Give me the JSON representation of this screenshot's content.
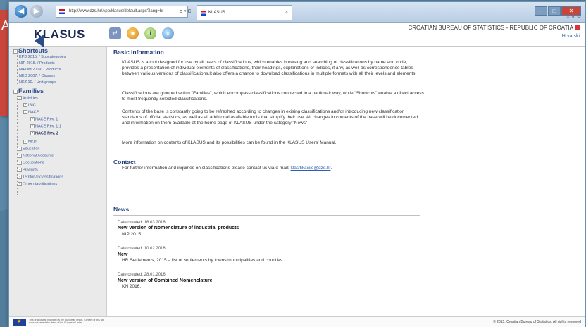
{
  "browser": {
    "address": "http://www.dzs.hr/App/klasus/default.aspx?lang=hr",
    "tab_title": "KLASUS",
    "back": "◀",
    "forward": "▶",
    "address_controls": "ρ ▾ C",
    "tab_close": "×",
    "win_min": "–",
    "win_max": "□",
    "win_close": "✕",
    "sys_icons": "⌂ ★ ⚙"
  },
  "header": {
    "logo": "KLASUS",
    "bureau": "CROATIAN BUREAU OF STATISTICS - REPUBLIC OF CROATIA",
    "language_link": "Hrvatski",
    "icon_home": "↵",
    "icon_globe": "●",
    "icon_info": "i",
    "icon_search": "⌕"
  },
  "sidebar": {
    "shortcuts_title": "Shortcuts",
    "shortcuts": [
      "KPD 2015. / Subcategories",
      "NIP 2015. / Products",
      "NIPUM 2009. / Products",
      "NKD 2007. / Classes",
      "NKZ 10. / Unit groups"
    ],
    "families_title": "Families",
    "activities": "Activities",
    "isic": "ISIC",
    "nace": "NACE",
    "nace_rev1": "NACE Rev. 1",
    "nace_rev11": "NACE Rev. 1.1",
    "nace_rev2": "NACE Rev. 2",
    "nkd": "NKD",
    "families_rest": [
      "Education",
      "National Accounts",
      "Occupations",
      "Products",
      "Territorial classifications",
      "Other classifications"
    ]
  },
  "main": {
    "basic_title": "Basic information",
    "p1": "KLASUS is a tool designed for use by all users of classifications, which enables browsing and searching of classifications by name and code, provides a presentation of individual elements of classifications, their headings, explanations or indices, if any, as well as correspondence tables between various versions of classifications.It also offers a chance to download classifications in multiple formats with all their levels and elements.",
    "p2": "Classifications are grouped within \"Families\", which encompass classifications connected in a particualr way, while \"Shortcuts\" enable a direct access to most frequently selected classifications.",
    "p3": "Contents of the base is constantly going to be refreshed according to changes in exising classifications and/or introducing new classification standards of official statistics, as well as all additional available tools that simplify their use. All changes in contents of the base will be documented and information on them available at the home page of KLASUS under the category \"News\".",
    "p4": "More information on contents of KLASUS and its possibilities can be found in the KLASUS Users' Manual.",
    "contact_title": "Contact",
    "contact_text": "For further information and inquiries on classifications please contact us via e-mail:",
    "contact_email": "klasifikacije@dzs.hr",
    "contact_end": ".",
    "news_title": "News",
    "news": [
      {
        "date": "Date created: 16.03.2016",
        "title": "New version of Nomenclature of industrial products",
        "sub": "NIP 2015."
      },
      {
        "date": "Date created: 10.02.2016",
        "title": "New",
        "sub": "HR Settlements, 2015 – list of settlements by towns/municipalities and counties"
      },
      {
        "date": "Date created: 28.01.2016",
        "title": "New version of Combined Nomenclature",
        "sub": "KN 2016."
      }
    ]
  },
  "footer": {
    "eu_text": "This project was financed by the European Union. Content of this site does not reflect the views of the European Union.",
    "eu_star": "★",
    "copyright": "© 2015. Croatian Bureau of Statistics. All rights reserved"
  },
  "background_letter": "A"
}
